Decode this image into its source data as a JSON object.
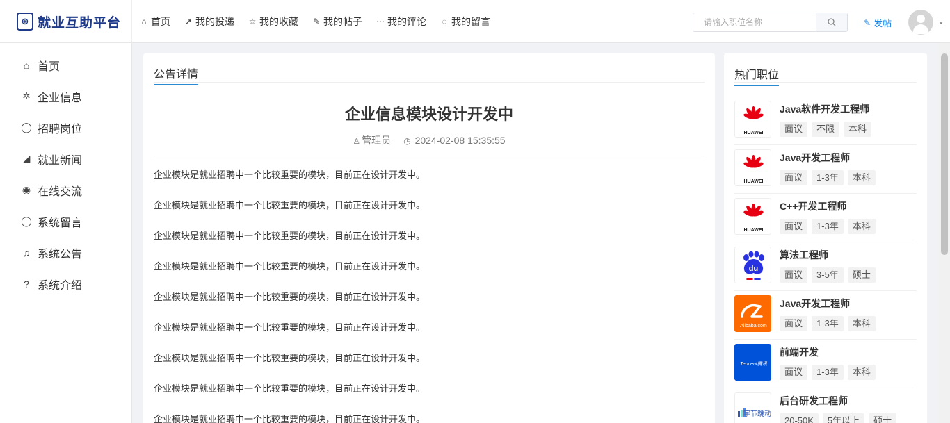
{
  "logo": {
    "text": "就业互助平台",
    "mark": "⊕"
  },
  "topnav": [
    {
      "icon": "home-icon",
      "glyph": "⌂",
      "label": "首页"
    },
    {
      "icon": "paper-plane-icon",
      "glyph": "➚",
      "label": "我的投递"
    },
    {
      "icon": "star-icon",
      "glyph": "☆",
      "label": "我的收藏"
    },
    {
      "icon": "edit-icon",
      "glyph": "✎",
      "label": "我的帖子"
    },
    {
      "icon": "comments-icon",
      "glyph": "💬",
      "label": "我的评论"
    },
    {
      "icon": "comment-icon",
      "glyph": "💬",
      "label": "我的留言"
    }
  ],
  "search": {
    "placeholder": "请输入职位名称",
    "button_glyph": "⚲"
  },
  "post_button": {
    "label": "发帖",
    "glyph": "✎"
  },
  "sidebar": [
    {
      "icon": "home-icon",
      "glyph": "⌂",
      "label": "首页"
    },
    {
      "icon": "company-icon",
      "glyph": "✲",
      "label": "企业信息"
    },
    {
      "icon": "bubble-icon",
      "glyph": "◯",
      "label": "招聘岗位"
    },
    {
      "icon": "rss-icon",
      "glyph": "◢",
      "label": "就业新闻"
    },
    {
      "icon": "chat-icon",
      "glyph": "◉",
      "label": "在线交流"
    },
    {
      "icon": "message-icon",
      "glyph": "◯",
      "label": "系统留言"
    },
    {
      "icon": "bell-icon",
      "glyph": "♫",
      "label": "系统公告"
    },
    {
      "icon": "help-icon",
      "glyph": "?",
      "label": "系统介绍"
    }
  ],
  "article": {
    "tab": "公告详情",
    "title": "企业信息模块设计开发中",
    "author": "管理员",
    "datetime": "2024-02-08 15:35:55",
    "paragraphs": [
      "企业模块是就业招聘中一个比较重要的模块，目前正在设计开发中。",
      "企业模块是就业招聘中一个比较重要的模块，目前正在设计开发中。",
      "企业模块是就业招聘中一个比较重要的模块，目前正在设计开发中。",
      "企业模块是就业招聘中一个比较重要的模块，目前正在设计开发中。",
      "企业模块是就业招聘中一个比较重要的模块，目前正在设计开发中。",
      "企业模块是就业招聘中一个比较重要的模块，目前正在设计开发中。",
      "企业模块是就业招聘中一个比较重要的模块，目前正在设计开发中。",
      "企业模块是就业招聘中一个比较重要的模块，目前正在设计开发中。",
      "企业模块是就业招聘中一个比较重要的模块，目前正在设计开发中。"
    ]
  },
  "hot_jobs": {
    "title": "热门职位",
    "items": [
      {
        "title": "Java软件开发工程师",
        "logo": "huawei",
        "logo_text": "HUAWEI",
        "tags": [
          "面议",
          "不限",
          "本科"
        ]
      },
      {
        "title": "Java开发工程师",
        "logo": "huawei",
        "logo_text": "HUAWEI",
        "tags": [
          "面议",
          "1-3年",
          "本科"
        ]
      },
      {
        "title": "C++开发工程师",
        "logo": "huawei",
        "logo_text": "HUAWEI",
        "tags": [
          "面议",
          "1-3年",
          "本科"
        ]
      },
      {
        "title": "算法工程师",
        "logo": "baidu",
        "logo_text": "du",
        "tags": [
          "面议",
          "3-5年",
          "硕士"
        ]
      },
      {
        "title": "Java开发工程师",
        "logo": "alibaba",
        "logo_text": "Alibaba.com",
        "tags": [
          "面议",
          "1-3年",
          "本科"
        ]
      },
      {
        "title": "前端开发",
        "logo": "tencent",
        "logo_text": "Tencent腾讯",
        "tags": [
          "面议",
          "1-3年",
          "本科"
        ]
      },
      {
        "title": "后台研发工程师",
        "logo": "bytedance",
        "logo_text": "字节跳动",
        "tags": [
          "20-50K",
          "5年以上",
          "硕士"
        ]
      }
    ]
  },
  "colors": {
    "accent": "#2a8bd2",
    "brand": "#1e3a8a",
    "link": "#1e88e5"
  }
}
